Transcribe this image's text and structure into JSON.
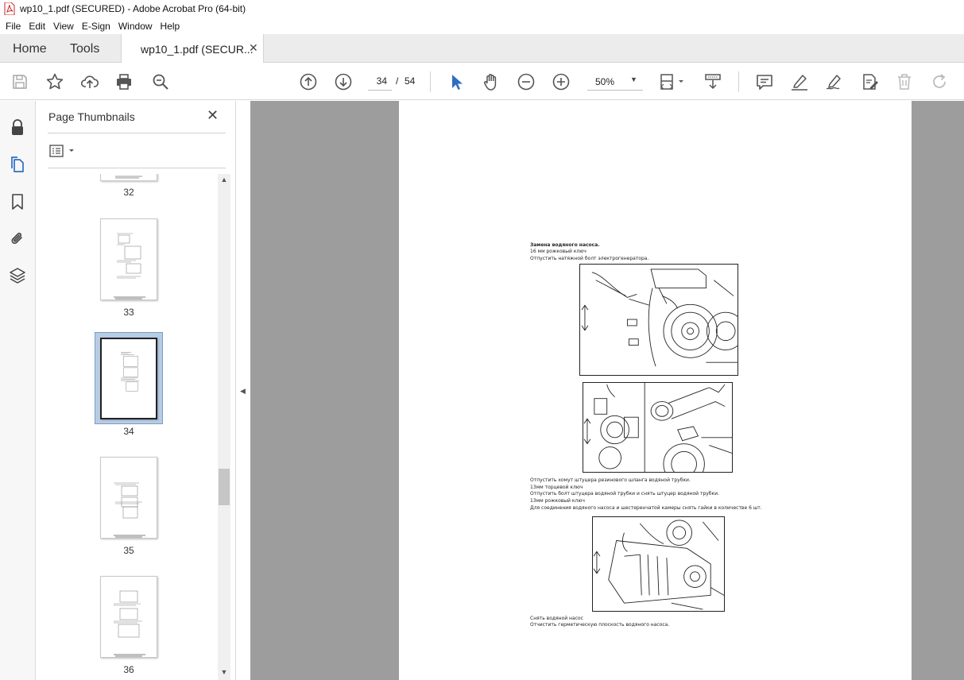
{
  "window": {
    "title": "wp10_1.pdf (SECURED) - Adobe Acrobat Pro (64-bit)"
  },
  "menu": [
    "File",
    "Edit",
    "View",
    "E-Sign",
    "Window",
    "Help"
  ],
  "tabs": {
    "home": "Home",
    "tools": "Tools",
    "document": "wp10_1.pdf (SECUR..."
  },
  "toolbar": {
    "current_page": "34",
    "page_separator": "/",
    "total_pages": "54",
    "zoom": "50%"
  },
  "thumbnails_panel": {
    "title": "Page Thumbnails",
    "pages": [
      "32",
      "33",
      "34",
      "35",
      "36"
    ],
    "selected": "34"
  },
  "document": {
    "heading": "Замена водяного насоса.",
    "line1": "16 мм рожковый ключ",
    "line2": "Отпустить натяжной болт электрогенератора.",
    "line3": "Отпустить хомут штуцера резинового шланга водяной трубки.",
    "line4": "13мм торцевой ключ",
    "line5": "Отпустить болт штуцера водяной трубки и снять штуцер водяной трубки.",
    "line6": "13мм рожковый ключ",
    "line7": "Для соединения водяного насоса и шестеренчатой камеры снять гайки в количестве 6 шт.",
    "line8": "Снять водяной насос",
    "line9": "Отчистить герметическую плоскость водяного насоса."
  },
  "colors": {
    "accent_blue": "#2d6fc4",
    "selection": "#b8cde4",
    "doc_background": "#9d9d9d"
  }
}
